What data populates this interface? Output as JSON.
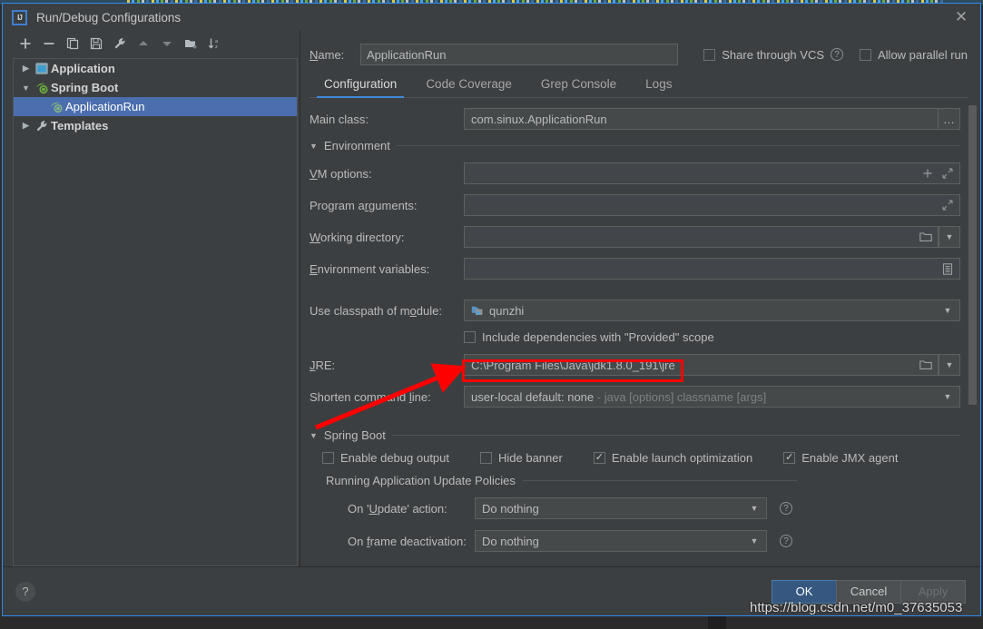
{
  "window": {
    "title": "Run/Debug Configurations",
    "logo_text": "IJ",
    "close_icon": "close-icon"
  },
  "tree_toolbar": {
    "items": [
      {
        "name": "add-configuration",
        "icon": "plus-icon",
        "glyph": "+"
      },
      {
        "name": "remove-configuration",
        "icon": "minus-icon",
        "glyph": "−"
      },
      {
        "name": "copy-configuration",
        "icon": "copy-icon",
        "glyph": ""
      },
      {
        "name": "save-configuration",
        "icon": "save-icon",
        "glyph": ""
      },
      {
        "name": "edit-templates",
        "icon": "wrench-icon",
        "glyph": ""
      },
      {
        "name": "move-up",
        "icon": "arrow-up-icon",
        "glyph": "▲"
      },
      {
        "name": "move-down",
        "icon": "arrow-down-icon",
        "glyph": "▼"
      },
      {
        "name": "new-folder",
        "icon": "folder-add-icon",
        "glyph": ""
      },
      {
        "name": "sort-alphabetically",
        "icon": "sort-az-icon",
        "glyph": ""
      }
    ]
  },
  "tree": {
    "items": [
      {
        "label": "Application",
        "icon": "application-icon",
        "arrow": "▶",
        "level": 0,
        "selected": false,
        "bold": true
      },
      {
        "label": "Spring Boot",
        "icon": "spring-boot-icon",
        "arrow": "▼",
        "level": 0,
        "selected": false,
        "bold": true
      },
      {
        "label": "ApplicationRun",
        "icon": "spring-boot-icon",
        "arrow": "",
        "level": 1,
        "selected": true,
        "bold": false
      },
      {
        "label": "Templates",
        "icon": "wrench-icon",
        "arrow": "▶",
        "level": 0,
        "selected": false,
        "bold": true
      }
    ]
  },
  "header": {
    "name_label": "Name:",
    "name_value": "ApplicationRun",
    "share_vcs_label": "Share through VCS",
    "share_vcs_checked": false,
    "allow_parallel_label": "Allow parallel run",
    "allow_parallel_checked": false,
    "help_icon": "help-icon"
  },
  "tabs": [
    {
      "label": "Configuration",
      "active": true
    },
    {
      "label": "Code Coverage",
      "active": false
    },
    {
      "label": "Grep Console",
      "active": false
    },
    {
      "label": "Logs",
      "active": false
    }
  ],
  "form": {
    "main_class_label": "Main class:",
    "main_class_value": "com.sinux.ApplicationRun",
    "main_class_browse": "…",
    "environment_section": "Environment",
    "vm_options_label": "VM options:",
    "vm_options_value": "",
    "program_arguments_label": "Program arguments:",
    "program_arguments_value": "",
    "working_directory_label": "Working directory:",
    "working_directory_value": "",
    "environment_variables_label": "Environment variables:",
    "environment_variables_value": "",
    "classpath_label": "Use classpath of module:",
    "classpath_value": "qunzhi",
    "include_provided_label": "Include dependencies with \"Provided\" scope",
    "include_provided_checked": false,
    "jre_label": "JRE:",
    "jre_value": "C:\\Program Files\\Java\\jdk1.8.0_191\\jre",
    "shorten_label": "Shorten command line:",
    "shorten_value": "user-local default: none",
    "shorten_value_sub": " - java [options] classname [args]"
  },
  "spring_boot": {
    "section_title": "Spring Boot",
    "checks": [
      {
        "label": "Enable debug output",
        "checked": false
      },
      {
        "label": "Hide banner",
        "checked": false
      },
      {
        "label": "Enable launch optimization",
        "checked": true
      },
      {
        "label": "Enable JMX agent",
        "checked": true
      }
    ],
    "policies_title": "Running Application Update Policies",
    "policies": [
      {
        "label": "On 'Update' action:",
        "value": "Do nothing"
      },
      {
        "label": "On frame deactivation:",
        "value": "Do nothing"
      }
    ]
  },
  "footer": {
    "help_label": "?",
    "ok_label": "OK",
    "cancel_label": "Cancel",
    "apply_label": "Apply"
  },
  "annotations": {
    "watermark": "https://blog.csdn.net/m0_37635053",
    "highlight_color": "#fe0000",
    "arrow_color": "#fe0000"
  },
  "colors": {
    "dialog_bg": "#3c3f41",
    "field_bg": "#45494a",
    "selection_blue": "#4b6eaf",
    "accent_blue": "#3f8ad6",
    "primary_button": "#365880",
    "border": "#2d8cf0"
  }
}
